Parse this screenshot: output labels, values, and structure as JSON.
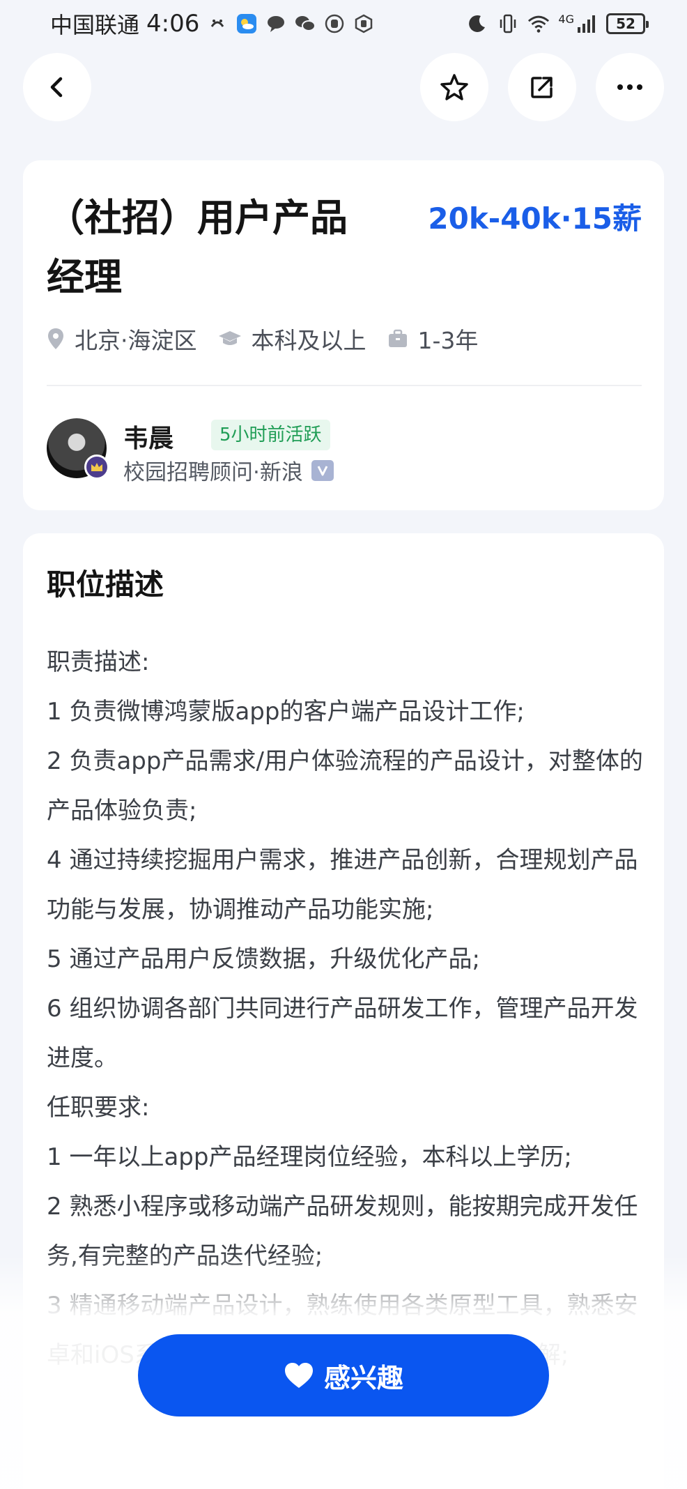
{
  "status_bar": {
    "carrier": "中国联通",
    "time": "4:06",
    "network": "4G",
    "battery": "52"
  },
  "job": {
    "title": "（社招）用户产品经理",
    "salary": "20k-40k·15薪",
    "location": "北京·海淀区",
    "education": "本科及以上",
    "experience": "1-3年"
  },
  "recruiter": {
    "name": "韦晨",
    "active_status": "5小时前活跃",
    "title": "校园招聘顾问·新浪"
  },
  "description": {
    "heading": "职位描述",
    "lines": [
      "职责描述:",
      "1 负责微博鸿蒙版app的客户端产品设计工作;",
      "2 负责app产品需求/用户体验流程的产品设计，对整体的产品体验负责;",
      "4 通过持续挖掘用户需求，推进产品创新，合理规划产品功能与发展，协调推动产品功能实施;",
      "5 通过产品用户反馈数据，升级优化产品;",
      "6 组织协调各部门共同进行产品研发工作，管理产品开发进度。",
      "任职要求:",
      "1 一年以上app产品经理岗位经验，本科以上学历;",
      "2 熟悉小程序或移动端产品研发规则，能按期完成开发任务,有完整的产品迭代经验;",
      "3 精通移动端产品设计，熟练使用各类原型工具，熟悉安卓和iOS系统的交互规范，对用户体验有深入理解;"
    ]
  },
  "cta": {
    "interest_label": "感兴趣"
  },
  "colors": {
    "accent": "#1a5ee8",
    "button": "#0a56f0",
    "active_green": "#1f9d55",
    "background": "#f3f5fa"
  }
}
